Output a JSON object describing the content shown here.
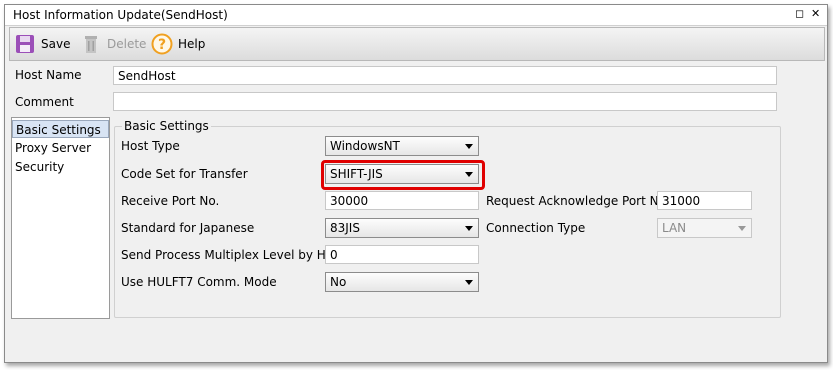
{
  "window": {
    "title": "Host Information Update(SendHost)",
    "restore_symbol": "◻",
    "close_symbol": "✕"
  },
  "toolbar": {
    "save_label": "Save",
    "delete_label": "Delete",
    "help_label": "Help"
  },
  "colors": {
    "highlight": "#e00000",
    "save_icon": "#9b4fb8",
    "help_icon": "#f0a020"
  },
  "fields": {
    "host_name": {
      "label": "Host Name",
      "value": "SendHost"
    },
    "comment": {
      "label": "Comment",
      "value": ""
    }
  },
  "nav": {
    "items": [
      "Basic Settings",
      "Proxy Server",
      "Security"
    ],
    "selected": "Basic Settings"
  },
  "basic_settings": {
    "group_title": "Basic Settings",
    "host_type": {
      "label": "Host Type",
      "value": "WindowsNT"
    },
    "code_set": {
      "label": "Code Set for Transfer",
      "value": "SHIFT-JIS"
    },
    "receive_port": {
      "label": "Receive Port No.",
      "value": "30000"
    },
    "request_ack_port": {
      "label": "Request Acknowledge Port No.",
      "value": "31000"
    },
    "standard_japanese": {
      "label": "Standard for Japanese",
      "value": "83JIS"
    },
    "connection_type": {
      "label": "Connection Type",
      "value": "LAN"
    },
    "multiplex_level": {
      "label": "Send Process Multiplex Level by Host",
      "value": "0"
    },
    "hulft7_mode": {
      "label": "Use HULFT7 Comm. Mode",
      "value": "No"
    }
  }
}
